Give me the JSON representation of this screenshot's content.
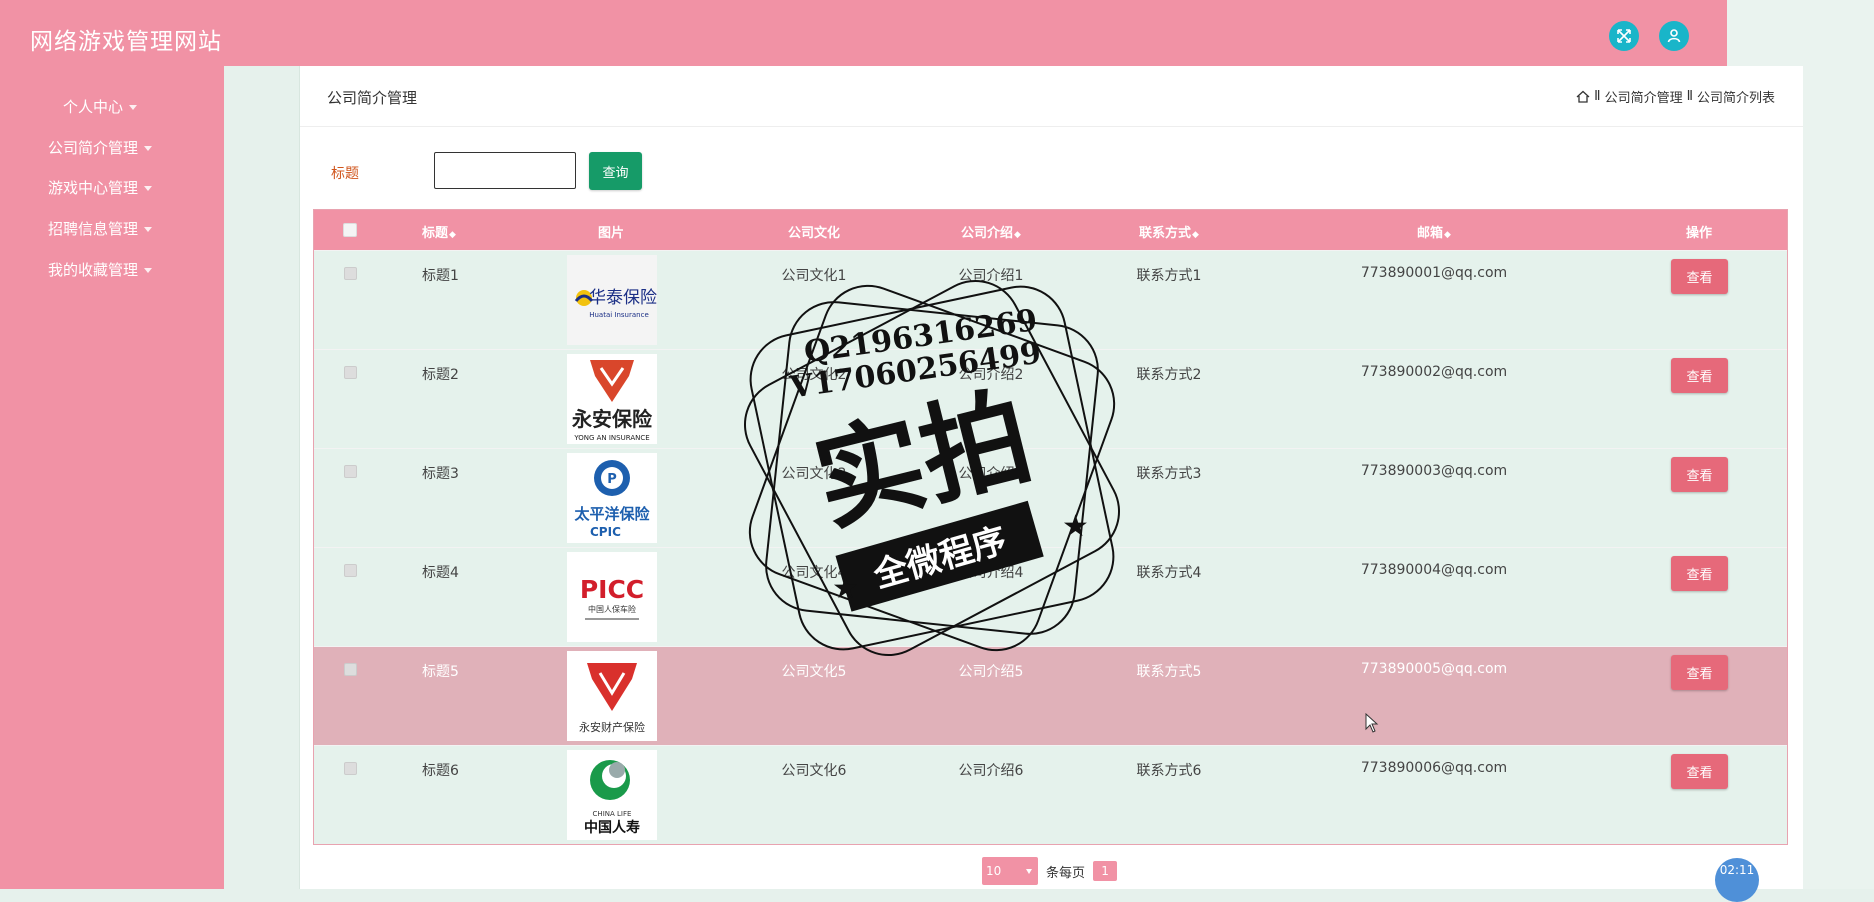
{
  "app": {
    "title": "网络游戏管理网站"
  },
  "sidebar": {
    "items": [
      {
        "label": "个人中心"
      },
      {
        "label": "公司简介管理"
      },
      {
        "label": "游戏中心管理"
      },
      {
        "label": "招聘信息管理"
      },
      {
        "label": "我的收藏管理"
      }
    ]
  },
  "page": {
    "title": "公司简介管理",
    "breadcrumb": [
      "公司简介管理",
      "公司简介列表"
    ],
    "breadcrumb_separator": "Ⅱ"
  },
  "search": {
    "label": "标题",
    "button": "查询",
    "value": ""
  },
  "table": {
    "headers": {
      "title": "标题",
      "image": "图片",
      "culture": "公司文化",
      "intro": "公司介绍",
      "contact": "联系方式",
      "email": "邮箱",
      "actions": "操作"
    },
    "view_label": "查看",
    "rows": [
      {
        "title": "标题1",
        "culture": "公司文化1",
        "intro": "公司介绍1",
        "contact": "联系方式1",
        "email": "773890001@qq.com",
        "logo_text": "华泰保险",
        "logo_sub": "Huatai Insurance"
      },
      {
        "title": "标题2",
        "culture": "公司文化2",
        "intro": "公司介绍2",
        "contact": "联系方式2",
        "email": "773890002@qq.com",
        "logo_text": "永安保险",
        "logo_sub": "YONG AN INSURANCE"
      },
      {
        "title": "标题3",
        "culture": "公司文化3",
        "intro": "公司介绍3",
        "contact": "联系方式3",
        "email": "773890003@qq.com",
        "logo_text": "太平洋保险",
        "logo_sub": "CPIC"
      },
      {
        "title": "标题4",
        "culture": "公司文化4",
        "intro": "公司介绍4",
        "contact": "联系方式4",
        "email": "773890004@qq.com",
        "logo_text": "PICC",
        "logo_sub": "中国人保车险"
      },
      {
        "title": "标题5",
        "culture": "公司文化5",
        "intro": "公司介绍5",
        "contact": "联系方式5",
        "email": "773890005@qq.com",
        "logo_text": "永安财产保险",
        "logo_sub": ""
      },
      {
        "title": "标题6",
        "culture": "公司文化6",
        "intro": "公司介绍6",
        "contact": "联系方式6",
        "email": "773890006@qq.com",
        "logo_text": "中国人寿",
        "logo_sub": "CHINA LIFE"
      }
    ]
  },
  "pagination": {
    "page_size": "10",
    "per_page_label": "条每页",
    "current_page": "1"
  },
  "timer": "02:11",
  "watermark": {
    "line1": "Q2196316269",
    "line2": "V17060256499",
    "main": "实拍",
    "banner": "全微程序"
  },
  "colors": {
    "brand_pink": "#f192a5",
    "accent_green": "#169b68",
    "action_red": "#e6697a",
    "icon_teal": "#19b5c9"
  }
}
